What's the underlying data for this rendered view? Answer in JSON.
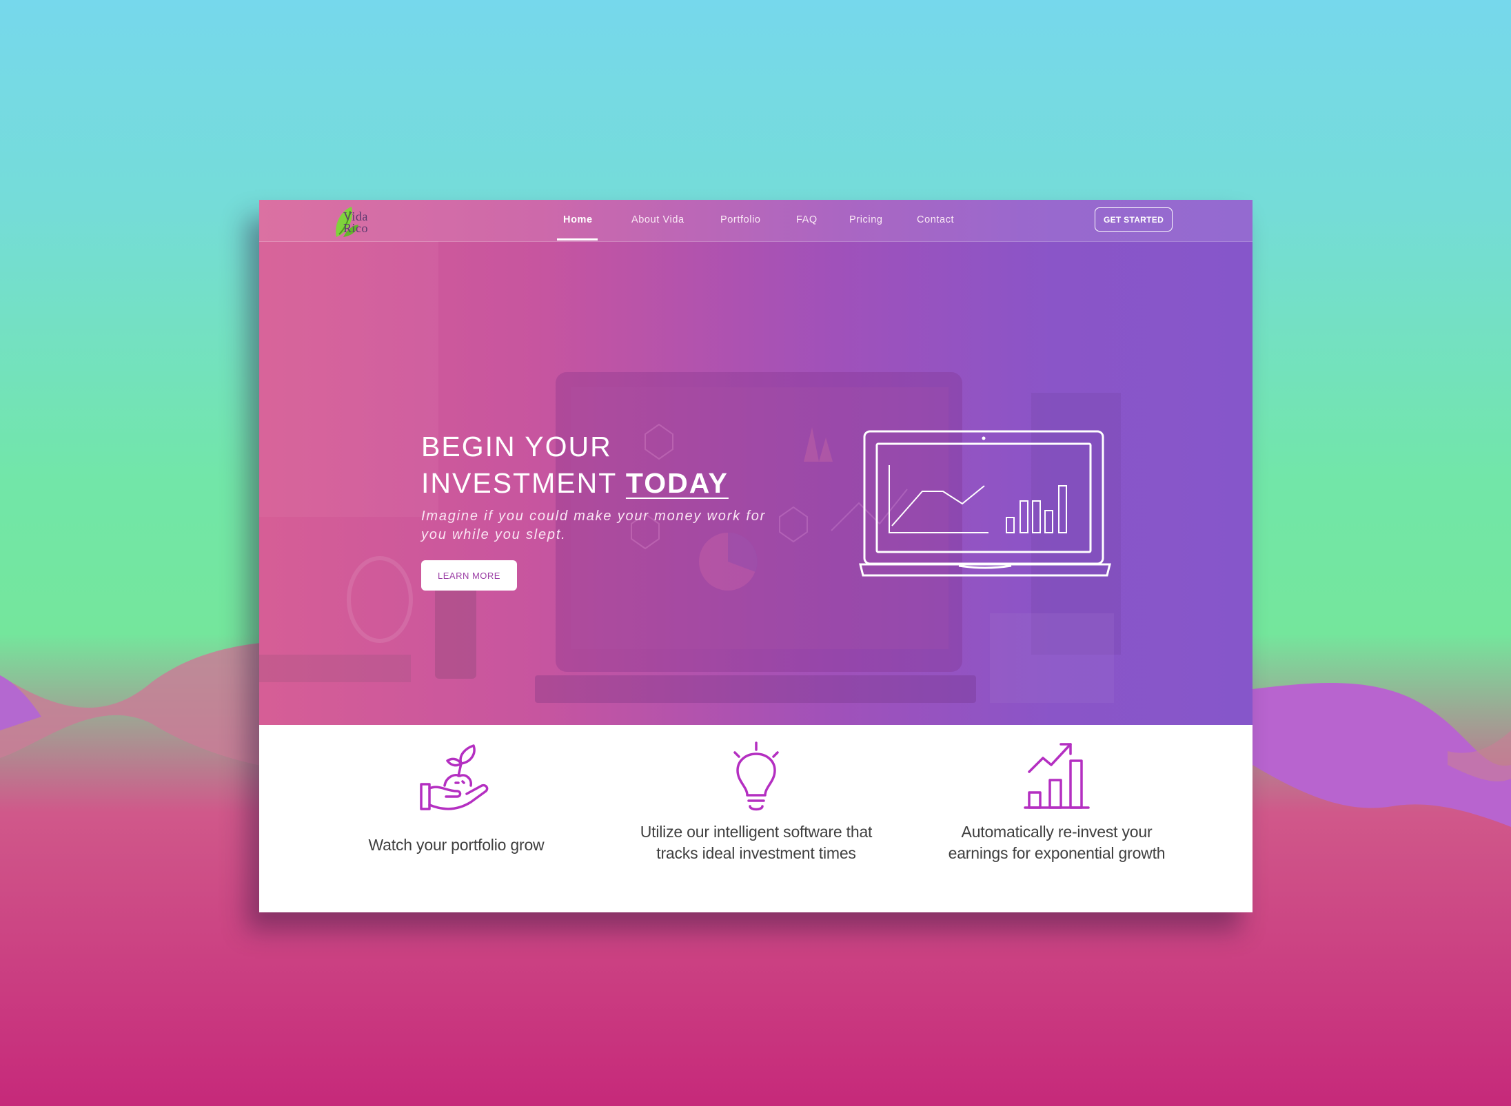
{
  "logo": {
    "line1": "Vida",
    "line2": "Rico"
  },
  "nav": {
    "items": [
      {
        "label": "Home",
        "active": true
      },
      {
        "label": "About Vida",
        "active": false
      },
      {
        "label": "Portfolio",
        "active": false
      },
      {
        "label": "FAQ",
        "active": false
      },
      {
        "label": "Pricing",
        "active": false
      },
      {
        "label": "Contact",
        "active": false
      }
    ],
    "cta_label": "GET STARTED"
  },
  "hero": {
    "title_line1": "BEGIN YOUR",
    "title_line2": "INVESTMENT",
    "title_accent": "TODAY",
    "subtitle": "Imagine if you could make your money work for you while you slept.",
    "button_label": "LEARN MORE"
  },
  "features": [
    {
      "icon": "plant-in-hand-icon",
      "text": "Watch your portfolio grow"
    },
    {
      "icon": "lightbulb-icon",
      "text": "Utilize our intelligent software that tracks ideal investment times"
    },
    {
      "icon": "growth-chart-icon",
      "text": "Automatically re-invest your earnings for exponential growth"
    }
  ],
  "colors": {
    "accent": "#b42fc1",
    "hero_left": "#d65e96",
    "hero_right": "#8656ca",
    "bg_top": "#76d8ec",
    "bg_bottom": "#c6297a"
  }
}
